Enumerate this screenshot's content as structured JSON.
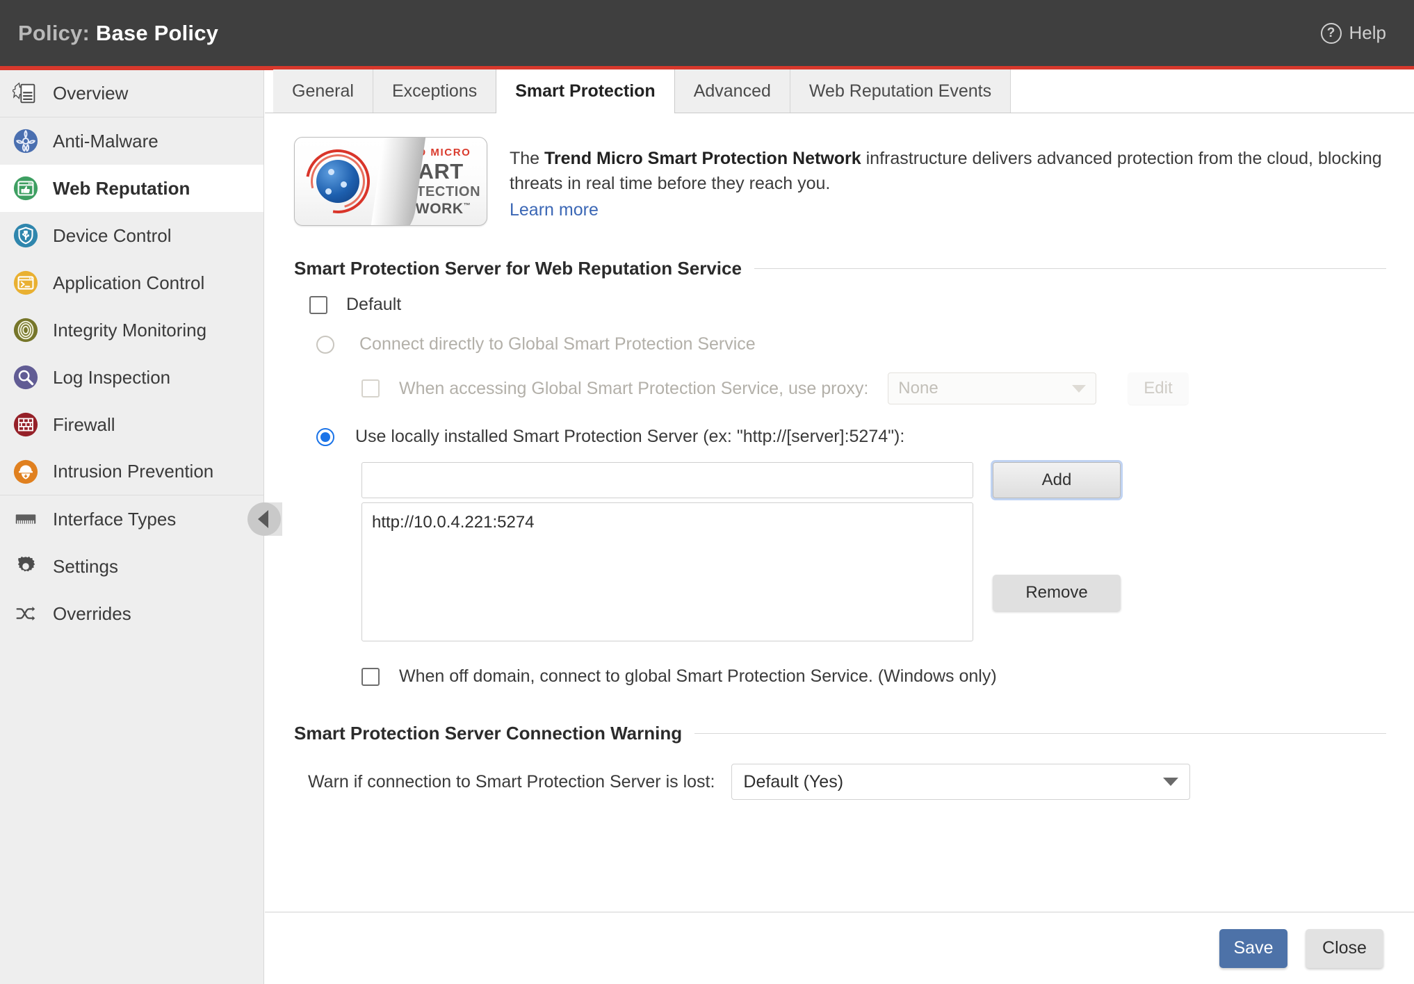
{
  "header": {
    "title_label": "Policy:",
    "title_value": "Base Policy",
    "help_label": "Help",
    "help_icon": "question-circle-icon",
    "accent_color": "#d8382c",
    "background_color": "#3f3f3f"
  },
  "sidebar": {
    "items": [
      {
        "label": "Overview",
        "icon": "overview-burst-document-icon",
        "color": "#5a5a5a",
        "active": false,
        "group_end": true
      },
      {
        "label": "Anti-Malware",
        "icon": "biohazard-icon",
        "color": "#4a6fb0",
        "active": false,
        "group_end": false
      },
      {
        "label": "Web Reputation",
        "icon": "browser-thumbsup-icon",
        "color": "#3e9f62",
        "active": true,
        "group_end": false
      },
      {
        "label": "Device Control",
        "icon": "usb-shield-icon",
        "color": "#2f86ad",
        "active": false,
        "group_end": false
      },
      {
        "label": "Application Control",
        "icon": "terminal-window-icon",
        "color": "#e9b031",
        "active": false,
        "group_end": false
      },
      {
        "label": "Integrity Monitoring",
        "icon": "fingerprint-icon",
        "color": "#76762a",
        "active": false,
        "group_end": false
      },
      {
        "label": "Log Inspection",
        "icon": "magnifier-icon",
        "color": "#615c94",
        "active": false,
        "group_end": false
      },
      {
        "label": "Firewall",
        "icon": "brick-wall-icon",
        "color": "#952028",
        "active": false,
        "group_end": false
      },
      {
        "label": "Intrusion Prevention",
        "icon": "helmet-shield-icon",
        "color": "#e0801f",
        "active": false,
        "group_end": true
      },
      {
        "label": "Interface Types",
        "icon": "network-card-icon",
        "color": "#5e5e5e",
        "active": false,
        "group_end": false
      },
      {
        "label": "Settings",
        "icon": "gear-icon",
        "color": "#4c4c4c",
        "active": false,
        "group_end": false
      },
      {
        "label": "Overrides",
        "icon": "shuffle-arrows-icon",
        "color": "#4c4c4c",
        "active": false,
        "group_end": false
      }
    ],
    "collapse_icon": "chevron-left-icon"
  },
  "tabs": [
    {
      "label": "General",
      "active": false
    },
    {
      "label": "Exceptions",
      "active": false
    },
    {
      "label": "Smart Protection",
      "active": true
    },
    {
      "label": "Advanced",
      "active": false
    },
    {
      "label": "Web Reputation Events",
      "active": false
    }
  ],
  "banner": {
    "logo": {
      "brand": "TREND MICRO",
      "line1": "SMART",
      "line2": "PROTECTION",
      "line3": "NETWORK",
      "trademark": "™"
    },
    "text_before": "The ",
    "text_bold": "Trend Micro Smart Protection Network",
    "text_after": " infrastructure delivers advanced protection from the cloud, blocking threats in real time before they reach you.",
    "link": "Learn more",
    "link_color": "#3b67b5"
  },
  "server_section": {
    "heading": "Smart Protection Server for Web Reputation Service",
    "default": {
      "label": "Default",
      "checked": false
    },
    "global_option": {
      "label": "Connect directly to Global Smart Protection Service",
      "selected": false,
      "disabled": true
    },
    "proxy": {
      "label": "When accessing Global Smart Protection Service, use proxy:",
      "checked": false,
      "disabled": true,
      "value": "None",
      "edit_label": "Edit",
      "caret_icon": "chevron-down-icon"
    },
    "local_option": {
      "label": "Use locally installed Smart Protection Server (ex: \"http://[server]:5274\"):",
      "selected": true
    },
    "server_input": {
      "value": "",
      "placeholder": ""
    },
    "add_label": "Add",
    "remove_label": "Remove",
    "server_list": [
      "http://10.0.4.221:5274"
    ],
    "off_domain": {
      "label": "When off domain, connect to global Smart Protection Service. (Windows only)",
      "checked": false
    }
  },
  "warning_section": {
    "heading": "Smart Protection Server Connection Warning",
    "label": "Warn if connection to Smart Protection Server is lost:",
    "value": "Default (Yes)",
    "caret_icon": "chevron-down-icon"
  },
  "footer": {
    "save_label": "Save",
    "close_label": "Close",
    "save_color": "#4d72a8"
  }
}
